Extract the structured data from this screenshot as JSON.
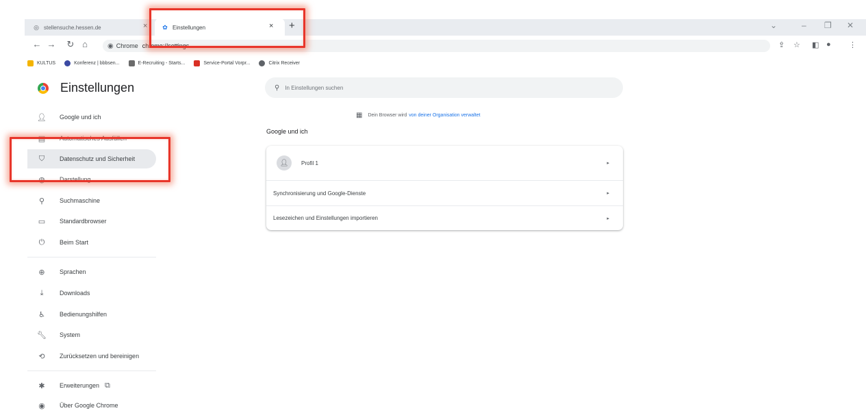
{
  "browser": {
    "tabs": [
      {
        "label": "stellensuche.hessen.de",
        "active": false,
        "icon": "globe-icon"
      },
      {
        "label": "Einstellungen",
        "active": true,
        "icon": "gear-icon"
      }
    ],
    "address": {
      "site_label": "Chrome",
      "url": "chrome://settings"
    },
    "bookmarks": [
      {
        "label": "KULTUS",
        "icon": "folder-icon",
        "color": "#f4b400"
      },
      {
        "label": "Konferenz | bbbsen...",
        "icon": "bbb-icon",
        "color": "#3b4aa3"
      },
      {
        "label": "E-Recruiting - Starts...",
        "icon": "page-icon",
        "color": "#6b6b6b"
      },
      {
        "label": "Service-Portal Vorpr...",
        "icon": "portal-icon",
        "color": "#d93025"
      },
      {
        "label": "Citrix Receiver",
        "icon": "citrix-icon",
        "color": "#5f6368"
      }
    ]
  },
  "settings": {
    "title": "Einstellungen",
    "search_placeholder": "In Einstellungen suchen",
    "nav_items": [
      {
        "label": "Google und ich",
        "icon": "person-icon"
      },
      {
        "label": "Automatisches Ausfüllen",
        "icon": "autofill-icon"
      },
      {
        "label": "Datenschutz und Sicherheit",
        "icon": "shield-icon"
      },
      {
        "label": "Darstellung",
        "icon": "palette-icon"
      },
      {
        "label": "Suchmaschine",
        "icon": "search-icon"
      },
      {
        "label": "Standardbrowser",
        "icon": "browser-icon"
      },
      {
        "label": "Beim Start",
        "icon": "power-icon"
      },
      {
        "label": "Sprachen",
        "icon": "globe-icon"
      },
      {
        "label": "Downloads",
        "icon": "download-icon"
      },
      {
        "label": "Bedienungshilfen",
        "icon": "accessibility-icon"
      },
      {
        "label": "System",
        "icon": "wrench-icon"
      },
      {
        "label": "Zurücksetzen und bereinigen",
        "icon": "reset-icon"
      },
      {
        "label": "Erweiterungen",
        "icon": "puzzle-icon"
      },
      {
        "label": "Über Google Chrome",
        "icon": "chrome-icon"
      }
    ],
    "managed_note": {
      "text": "Dein Browser wird",
      "link": "von deiner Organisation verwaltet"
    },
    "section_title": "Google und ich",
    "card_rows": [
      {
        "label": "Profil 1"
      },
      {
        "label": "Synchronisierung und Google-Dienste"
      },
      {
        "label": "Lesezeichen und Einstellungen importieren"
      }
    ]
  },
  "colors": {
    "highlight": "#e8352a",
    "link": "#1a73e8",
    "active_nav": "#e8eaed"
  }
}
